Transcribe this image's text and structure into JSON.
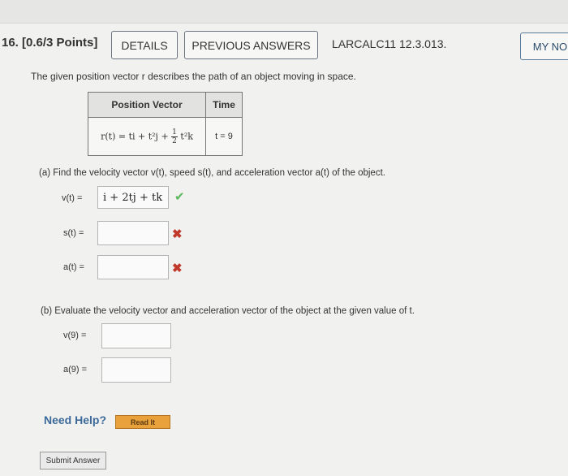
{
  "question": {
    "number_label": "16. [0.6/3 Points]",
    "details_label": "DETAILS",
    "previous_answers_label": "PREVIOUS ANSWERS",
    "course_code": "LARCALC11 12.3.013.",
    "my_notes_label": "MY NO"
  },
  "intro": "The given position vector r describes the path of an object moving in space.",
  "table": {
    "header_position": "Position Vector",
    "header_time": "Time",
    "position_prefix": "r(t) = ti + t²j +",
    "frac_num": "1",
    "frac_den": "2",
    "position_suffix": "t²k",
    "time_value": "t = 9"
  },
  "part_a": {
    "prompt": "(a)  Find the velocity vector v(t), speed s(t), and acceleration vector a(t) of the object.",
    "v_label": "v(t)  =",
    "v_value": "i + 2tj + tk",
    "s_label": "s(t)  =",
    "a_label": "a(t)  =",
    "check_icon": "✔",
    "cross_icon": "✖"
  },
  "part_b": {
    "prompt": "(b)  Evaluate the velocity vector and acceleration vector of the object at the given value of t.",
    "v9_label": "v(9)  =",
    "a9_label": "a(9)  ="
  },
  "help": {
    "need_help": "Need Help?",
    "read_it": "Read It"
  },
  "submit_label": "Submit Answer",
  "colors": {
    "check": "#5cb85c",
    "cross": "#c0392b",
    "need_help": "#3c6a9a",
    "read_it_bg": "#e9a23b"
  }
}
